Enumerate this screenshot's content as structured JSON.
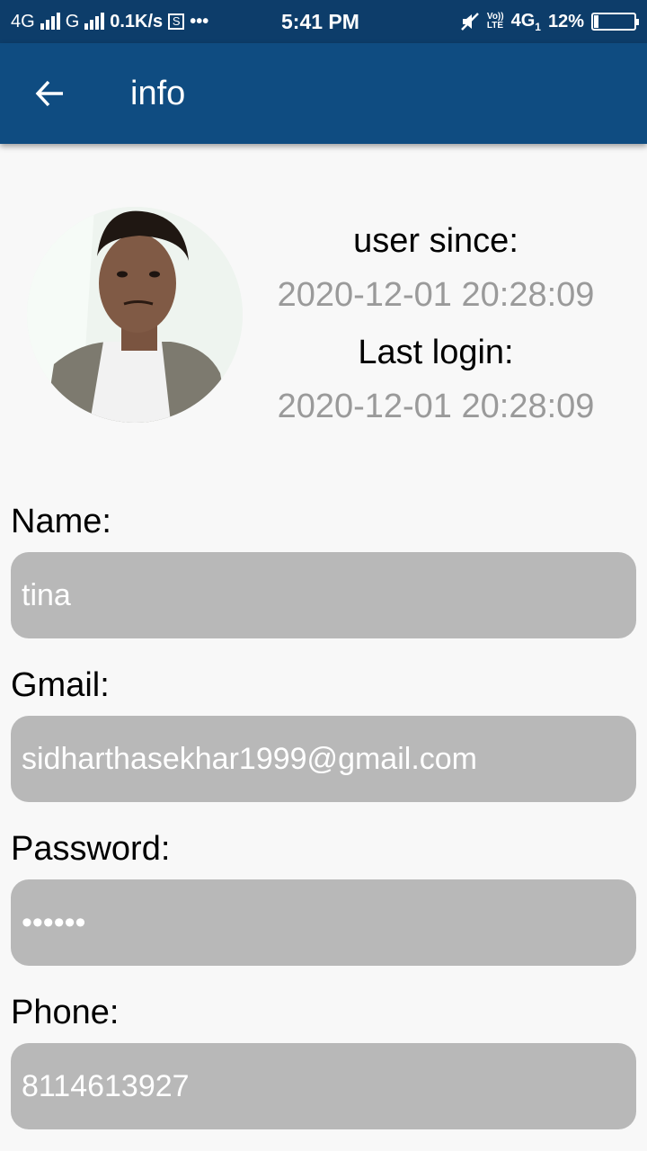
{
  "status_bar": {
    "net1": "4G",
    "net2": "G",
    "speed": "0.1K/s",
    "s_box": "S",
    "more": "•••",
    "time": "5:41 PM",
    "volte_top": "Vo))",
    "volte_bottom": "LTE",
    "net3": "4G",
    "net3_sub": "1",
    "battery": "12%",
    "battery_level": 0.12
  },
  "appbar": {
    "title": "info"
  },
  "profile": {
    "user_since_label": "user since:",
    "user_since_value": "2020-12-01 20:28:09",
    "last_login_label": "Last login:",
    "last_login_value": "2020-12-01 20:28:09"
  },
  "fields": {
    "name_label": "Name:",
    "name_value": "tina",
    "gmail_label": "Gmail:",
    "gmail_value": "sidharthasekhar1999@gmail.com",
    "password_label": "Password:",
    "password_value": "••••••",
    "phone_label": "Phone:",
    "phone_value": "8114613927"
  },
  "colors": {
    "status_bar": "#0d3d6a",
    "app_bar": "#0f4c81",
    "field_bg": "#b8b8b8",
    "secondary_text": "#9a9a9a"
  }
}
